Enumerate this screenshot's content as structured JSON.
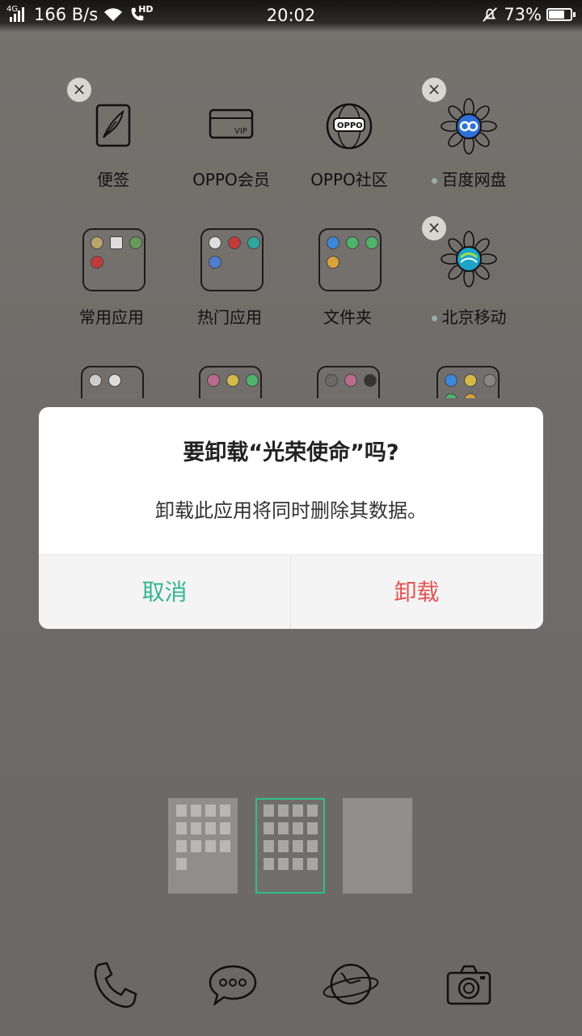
{
  "status_bar": {
    "network_type": "4G",
    "data_speed": "166 B/s",
    "hd_badge": "HD",
    "time": "20:02",
    "battery_percent": "73%",
    "battery_level": 0.73
  },
  "home": {
    "row1": [
      {
        "label": "便签",
        "icon": "note-pen-icon"
      },
      {
        "label": "OPPO会员",
        "icon": "vip-card-icon"
      },
      {
        "label": "OPPO社区",
        "icon": "oppo-globe-icon"
      },
      {
        "label": "百度网盘",
        "icon": "baidu-netdisk-icon"
      }
    ],
    "row2": [
      {
        "label": "常用应用",
        "icon": "folder-icon"
      },
      {
        "label": "热门应用",
        "icon": "folder-icon"
      },
      {
        "label": "文件夹",
        "icon": "folder-icon"
      },
      {
        "label": "北京移动",
        "icon": "china-mobile-icon"
      }
    ],
    "delete_glyph": "×"
  },
  "dialog": {
    "title": "要卸载“光荣使命”吗?",
    "message": "卸载此应用将同时删除其数据。",
    "cancel_label": "取消",
    "confirm_label": "卸载",
    "cancel_color": "#33b58e",
    "confirm_color": "#e55453"
  },
  "dock": [
    {
      "icon": "phone-icon"
    },
    {
      "icon": "messages-icon"
    },
    {
      "icon": "browser-globe-icon"
    },
    {
      "icon": "camera-icon"
    }
  ]
}
